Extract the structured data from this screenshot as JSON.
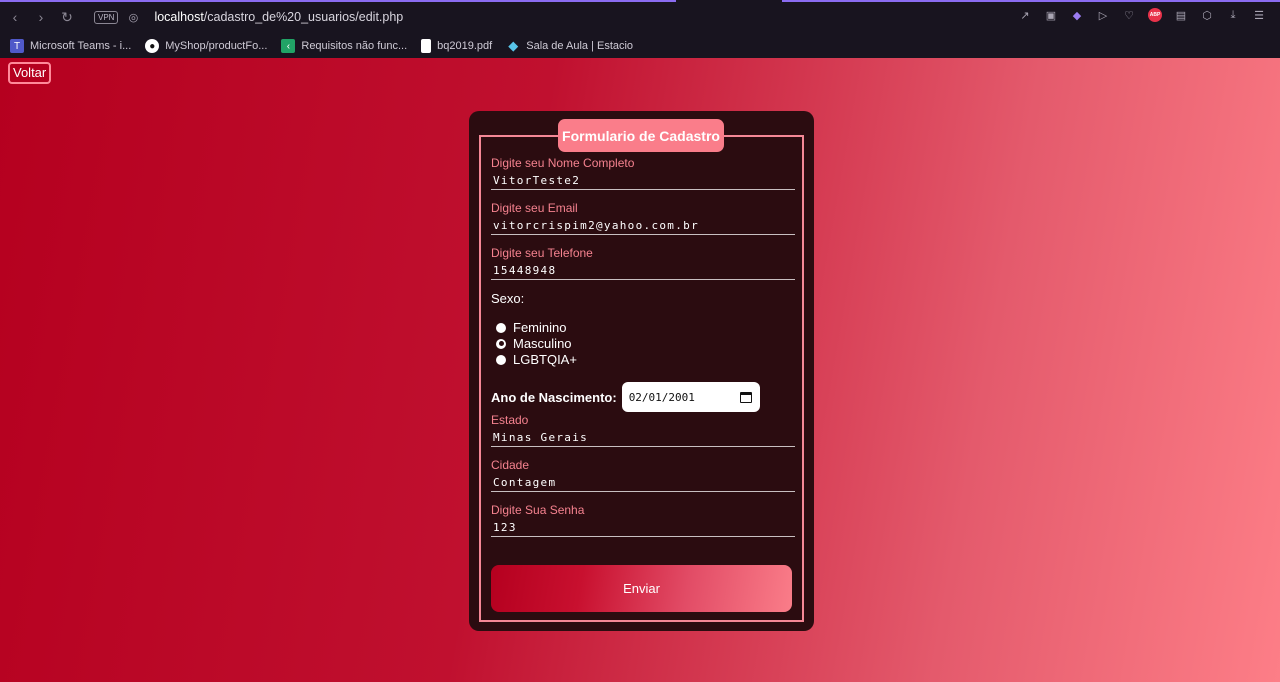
{
  "browser": {
    "url_host": "localhost",
    "url_path": "/cadastro_de%20_usuarios/edit.php",
    "vpn_label": "VPN",
    "abp_label": "ABP",
    "bookmarks": [
      {
        "label": "Microsoft Teams - i...",
        "icon": "teams-icon"
      },
      {
        "label": "MyShop/productFo...",
        "icon": "github-icon"
      },
      {
        "label": "Requisitos não func...",
        "icon": "sheet-icon"
      },
      {
        "label": "bq2019.pdf",
        "icon": "file-icon"
      },
      {
        "label": "Sala de Aula | Estacio",
        "icon": "diamond-icon"
      }
    ]
  },
  "page": {
    "back_label": "Voltar",
    "form_title": "Formulario de Cadastro",
    "fields": {
      "nome": {
        "label": "Digite seu Nome Completo",
        "value": "VitorTeste2"
      },
      "email": {
        "label": "Digite seu Email",
        "value": "vitorcrispim2@yahoo.com.br"
      },
      "telefone": {
        "label": "Digite seu Telefone",
        "value": "15448948"
      },
      "estado": {
        "label": "Estado",
        "value": "Minas Gerais"
      },
      "cidade": {
        "label": "Cidade",
        "value": "Contagem"
      },
      "senha": {
        "label": "Digite Sua Senha",
        "value": "123"
      }
    },
    "sexo": {
      "label": "Sexo:",
      "options": [
        "Feminino",
        "Masculino",
        "LGBTQIA+"
      ],
      "selected": "Masculino"
    },
    "nascimento": {
      "label": "Ano de Nascimento:",
      "value": "02/01/2001"
    },
    "submit_label": "Enviar"
  }
}
